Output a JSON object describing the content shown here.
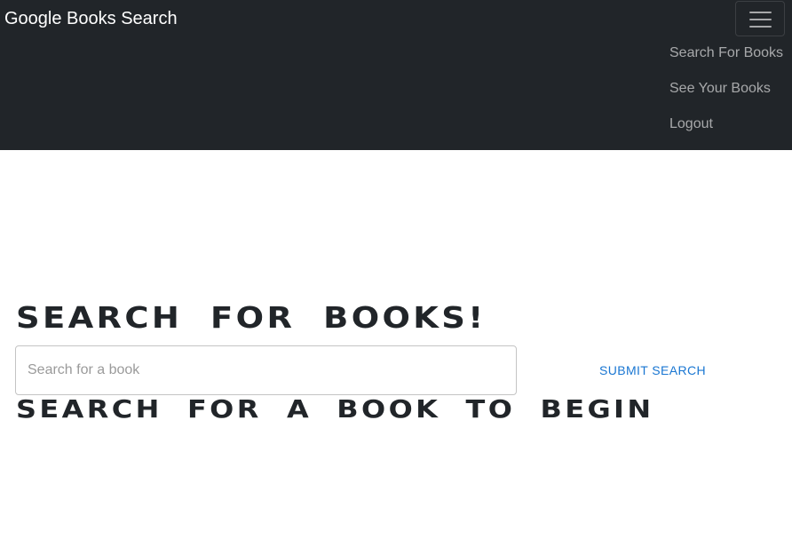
{
  "navbar": {
    "brand": "Google Books Search",
    "toggler_icon": "hamburger-menu-icon",
    "links": [
      {
        "label": "Search For Books"
      },
      {
        "label": "See Your Books"
      },
      {
        "label": "Logout"
      }
    ]
  },
  "main": {
    "heading": "Search for Books!",
    "search": {
      "placeholder": "Search for a book",
      "value": ""
    },
    "submit_label": "Submit Search",
    "results_heading": "Search for a book to begin"
  },
  "colors": {
    "navbar_bg": "#212529",
    "accent": "#1976d2",
    "text": "#212529"
  }
}
